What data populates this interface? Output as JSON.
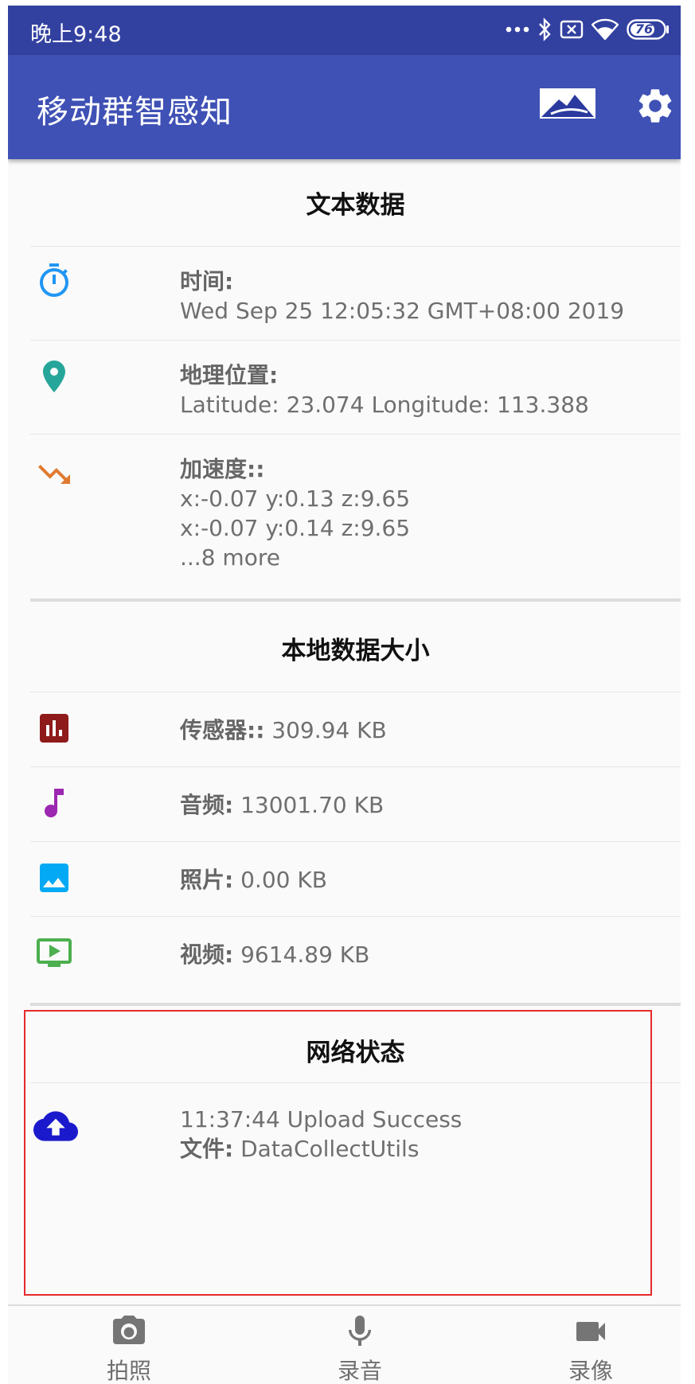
{
  "status_bar": {
    "time": "晚上9:48",
    "battery": "76",
    "icons": [
      "more-dots-icon",
      "bluetooth-icon",
      "sim-error-icon",
      "wifi-icon",
      "battery-icon"
    ]
  },
  "app_bar": {
    "title": "移动群智感知",
    "icons": [
      "app-logo-icon",
      "gear-icon"
    ]
  },
  "text_data": {
    "header": "文本数据",
    "rows": [
      {
        "icon": "timer-icon",
        "icon_color": "#2196f3",
        "label": "时间:",
        "lines": [
          "Wed Sep 25 12:05:32 GMT+08:00 2019"
        ]
      },
      {
        "icon": "location-pin-icon",
        "icon_color": "#26a69a",
        "label": "地理位置:",
        "lines": [
          "Latitude: 23.074 Longitude: 113.388"
        ]
      },
      {
        "icon": "trending-down-icon",
        "icon_color": "#e07a30",
        "label": "加速度::",
        "lines": [
          "x:-0.07 y:0.13 z:9.65",
          "x:-0.07 y:0.14 z:9.65",
          "...8 more"
        ]
      }
    ]
  },
  "local_data": {
    "header": "本地数据大小",
    "rows": [
      {
        "icon": "bar-chart-icon",
        "icon_color": "#8e1a1a",
        "label": "传感器::",
        "value": " 309.94 KB"
      },
      {
        "icon": "music-note-icon",
        "icon_color": "#9c27b0",
        "label": "音频:",
        "value": " 13001.70 KB"
      },
      {
        "icon": "image-icon",
        "icon_color": "#03a9f4",
        "label": "照片:",
        "value": " 0.00 KB"
      },
      {
        "icon": "video-play-icon",
        "icon_color": "#4caf50",
        "label": "视频:",
        "value": " 9614.89 KB"
      }
    ]
  },
  "network": {
    "header": "网络状态",
    "icon": "cloud-upload-icon",
    "icon_color": "#1a1acc",
    "status_line": "11:37:44  Upload Success",
    "file_label": "文件:",
    "file_value": " DataCollectUtils"
  },
  "bottom_nav": [
    {
      "icon": "camera-icon",
      "label": "拍照"
    },
    {
      "icon": "microphone-icon",
      "label": "录音"
    },
    {
      "icon": "videocam-icon",
      "label": "录像"
    }
  ],
  "colors": {
    "status_bar": "#3241a0",
    "app_bar": "#3f51b5",
    "highlight": "#e52b2b"
  }
}
